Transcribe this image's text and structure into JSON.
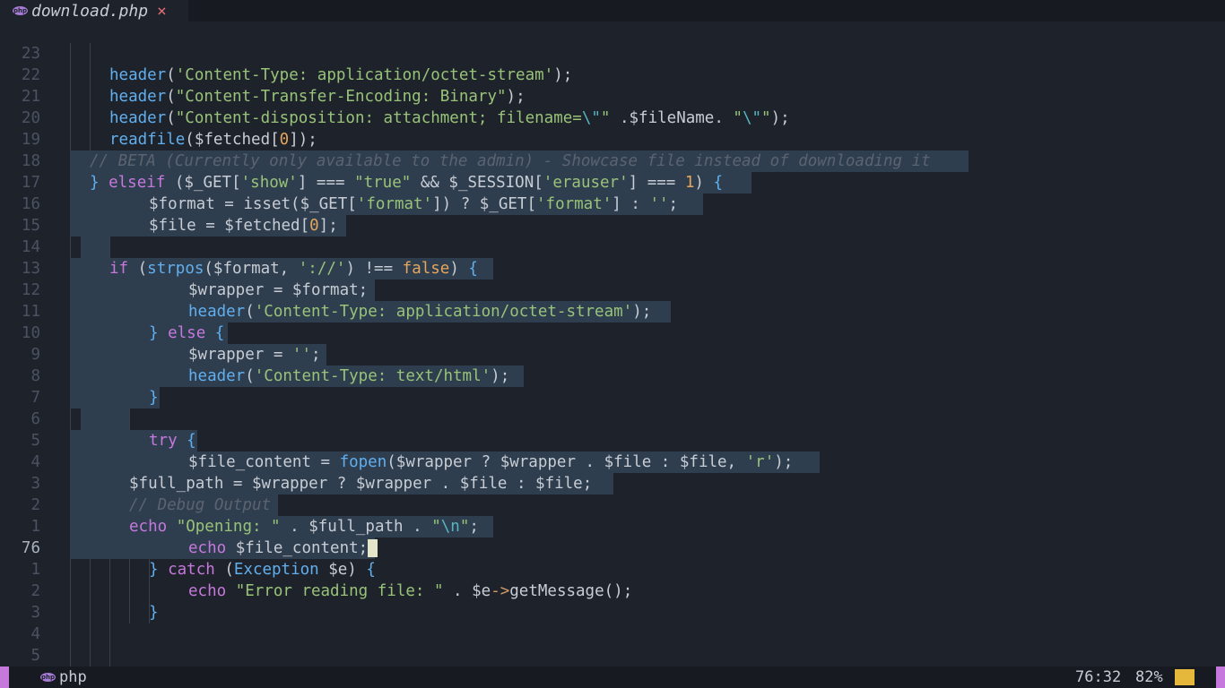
{
  "tab": {
    "title": "download.php",
    "icon": "php-file-icon",
    "close_glyph": "×"
  },
  "editor": {
    "line_numbers": [
      "23",
      "22",
      "21",
      "20",
      "19",
      "18",
      "17",
      "16",
      "15",
      "14",
      "13",
      "12",
      "11",
      "10",
      "9",
      "8",
      "7",
      "6",
      "5",
      "4",
      "3",
      "2",
      "1",
      "76",
      "1",
      "2",
      "3",
      "4",
      "5"
    ],
    "current_line": "76"
  },
  "status": {
    "language": "php",
    "position": "76:32",
    "percent": "82%",
    "badge": "php"
  },
  "colors": {
    "background": "#1e222a",
    "selection": "#2e3e4e",
    "accent": "#c678dd",
    "mode_indicator": "#e5b73a"
  }
}
